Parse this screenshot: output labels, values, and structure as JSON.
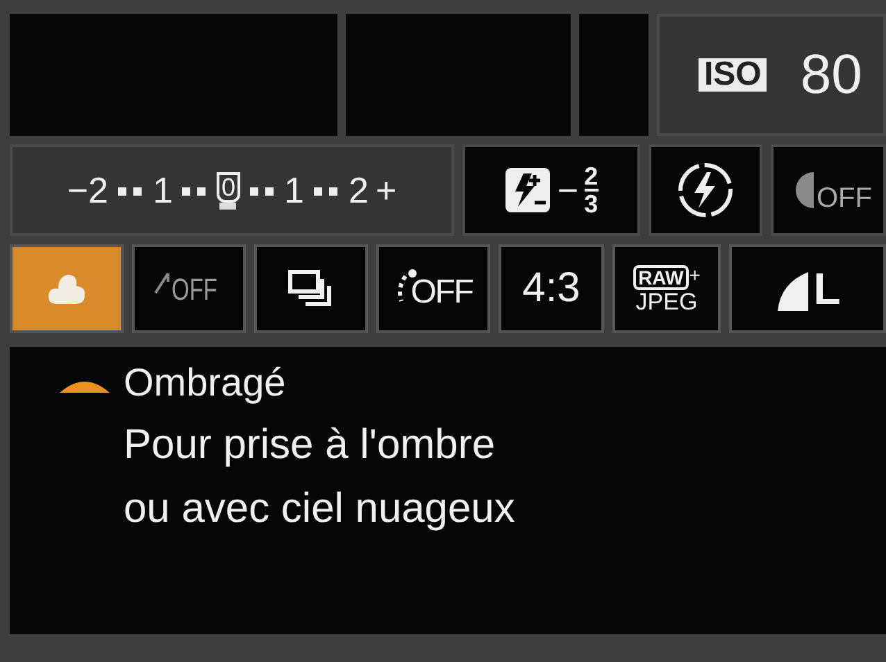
{
  "top_row": {
    "iso": {
      "badge": "ISO",
      "value": "80"
    }
  },
  "exposure": {
    "labels": [
      {
        "text": "−2",
        "selected": false
      },
      {
        "text": "1",
        "selected": false
      },
      {
        "text": "0",
        "selected": true
      },
      {
        "text": "1",
        "selected": false
      },
      {
        "text": "2",
        "selected": false
      }
    ],
    "plus": "+"
  },
  "flash_comp": {
    "sign": "−",
    "numerator": "2",
    "denominator": "3"
  },
  "flash_off_text": "OFF",
  "settings": [
    {
      "kind": "wb_shade",
      "selected": true
    },
    {
      "kind": "auto_lighting",
      "text": "OFF",
      "selected": false
    },
    {
      "kind": "drive",
      "selected": false
    },
    {
      "kind": "self_timer",
      "text": "OFF",
      "selected": false
    },
    {
      "kind": "aspect",
      "text": "4:3",
      "selected": false
    },
    {
      "kind": "quality",
      "badge": "RAW",
      "plus": "+",
      "text": "JPEG",
      "selected": false
    },
    {
      "kind": "size",
      "text": "L",
      "selected": false
    }
  ],
  "description": {
    "title": "Ombragé",
    "lines": [
      "Pour prise à l'ombre",
      "ou avec ciel nuageux"
    ]
  }
}
